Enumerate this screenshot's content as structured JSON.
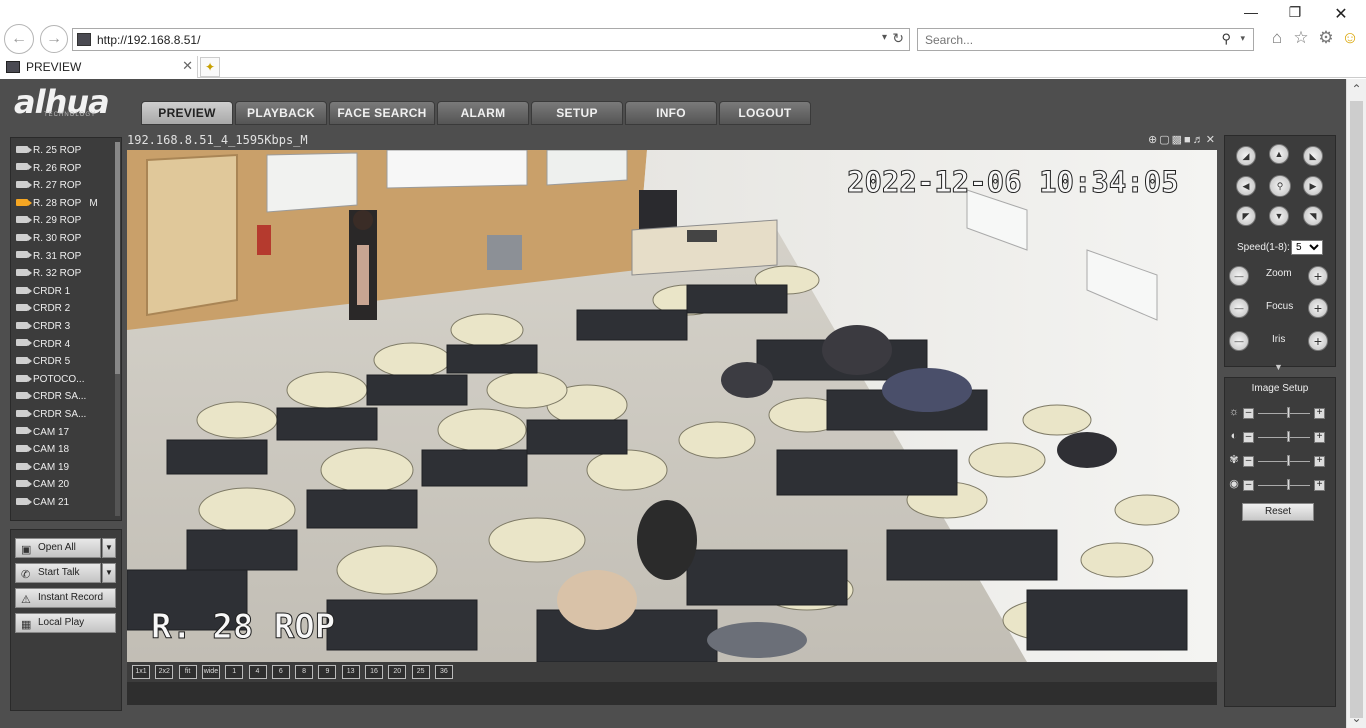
{
  "browser": {
    "address_url": "http://192.168.8.51/",
    "search_placeholder": "Search...",
    "tab_title": "PREVIEW"
  },
  "app": {
    "logo_text": "alhua",
    "logo_sub": "TECHNOLOGY",
    "nav": [
      "PREVIEW",
      "PLAYBACK",
      "FACE SEARCH",
      "ALARM",
      "SETUP",
      "INFO",
      "LOGOUT"
    ],
    "active_nav": "PREVIEW"
  },
  "cameras": [
    {
      "label": "R. 25 ROP",
      "mark": ""
    },
    {
      "label": "R. 26 ROP",
      "mark": ""
    },
    {
      "label": "R. 27 ROP",
      "mark": ""
    },
    {
      "label": "R. 28 ROP",
      "mark": "M"
    },
    {
      "label": "R. 29 ROP",
      "mark": ""
    },
    {
      "label": "R. 30 ROP",
      "mark": ""
    },
    {
      "label": "R. 31 ROP",
      "mark": ""
    },
    {
      "label": "R. 32 ROP",
      "mark": ""
    },
    {
      "label": "CRDR 1",
      "mark": ""
    },
    {
      "label": "CRDR 2",
      "mark": ""
    },
    {
      "label": "CRDR 3",
      "mark": ""
    },
    {
      "label": "CRDR 4",
      "mark": ""
    },
    {
      "label": "CRDR 5",
      "mark": ""
    },
    {
      "label": "POTOCO...",
      "mark": ""
    },
    {
      "label": "CRDR SA...",
      "mark": ""
    },
    {
      "label": "CRDR SA...",
      "mark": ""
    },
    {
      "label": "CAM 17",
      "mark": ""
    },
    {
      "label": "CAM 18",
      "mark": ""
    },
    {
      "label": "CAM 19",
      "mark": ""
    },
    {
      "label": "CAM 20",
      "mark": ""
    },
    {
      "label": "CAM 21",
      "mark": ""
    }
  ],
  "actions": {
    "open_all": "Open All",
    "start_talk": "Start Talk",
    "instant_record": "Instant Record",
    "local_play": "Local Play"
  },
  "video": {
    "stream_info": "192.168.8.51_4_1595Kbps_M",
    "timestamp": "2022-12-06 10:34:05",
    "camera_overlay": "R. 28 ROP"
  },
  "layouts": [
    "1x1",
    "2x2",
    "fit",
    "wide",
    "1",
    "4",
    "6",
    "8",
    "9",
    "13",
    "16",
    "20",
    "25",
    "36"
  ],
  "ptz": {
    "speed_label": "Speed(1-8):",
    "speed_value": "5",
    "zoom": "Zoom",
    "focus": "Focus",
    "iris": "Iris"
  },
  "image_setup": {
    "title": "Image Setup",
    "reset": "Reset",
    "levels": [
      0.6,
      0.6,
      0.6,
      0.6
    ]
  }
}
